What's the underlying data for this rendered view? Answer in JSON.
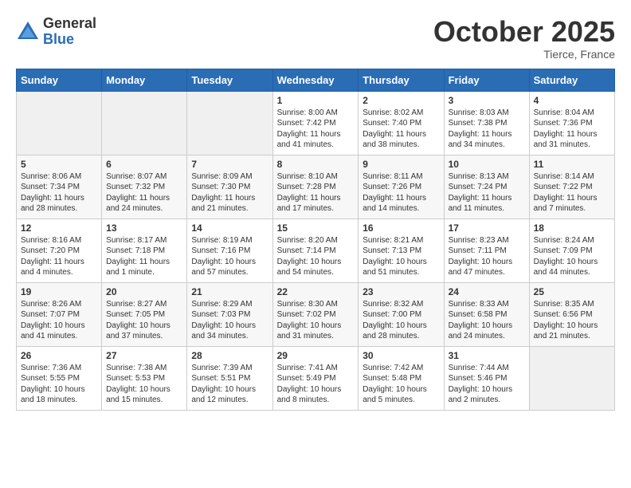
{
  "logo": {
    "general": "General",
    "blue": "Blue"
  },
  "header": {
    "month": "October 2025",
    "location": "Tierce, France"
  },
  "days_of_week": [
    "Sunday",
    "Monday",
    "Tuesday",
    "Wednesday",
    "Thursday",
    "Friday",
    "Saturday"
  ],
  "weeks": [
    [
      {
        "day": "",
        "info": ""
      },
      {
        "day": "",
        "info": ""
      },
      {
        "day": "",
        "info": ""
      },
      {
        "day": "1",
        "info": "Sunrise: 8:00 AM\nSunset: 7:42 PM\nDaylight: 11 hours and 41 minutes."
      },
      {
        "day": "2",
        "info": "Sunrise: 8:02 AM\nSunset: 7:40 PM\nDaylight: 11 hours and 38 minutes."
      },
      {
        "day": "3",
        "info": "Sunrise: 8:03 AM\nSunset: 7:38 PM\nDaylight: 11 hours and 34 minutes."
      },
      {
        "day": "4",
        "info": "Sunrise: 8:04 AM\nSunset: 7:36 PM\nDaylight: 11 hours and 31 minutes."
      }
    ],
    [
      {
        "day": "5",
        "info": "Sunrise: 8:06 AM\nSunset: 7:34 PM\nDaylight: 11 hours and 28 minutes."
      },
      {
        "day": "6",
        "info": "Sunrise: 8:07 AM\nSunset: 7:32 PM\nDaylight: 11 hours and 24 minutes."
      },
      {
        "day": "7",
        "info": "Sunrise: 8:09 AM\nSunset: 7:30 PM\nDaylight: 11 hours and 21 minutes."
      },
      {
        "day": "8",
        "info": "Sunrise: 8:10 AM\nSunset: 7:28 PM\nDaylight: 11 hours and 17 minutes."
      },
      {
        "day": "9",
        "info": "Sunrise: 8:11 AM\nSunset: 7:26 PM\nDaylight: 11 hours and 14 minutes."
      },
      {
        "day": "10",
        "info": "Sunrise: 8:13 AM\nSunset: 7:24 PM\nDaylight: 11 hours and 11 minutes."
      },
      {
        "day": "11",
        "info": "Sunrise: 8:14 AM\nSunset: 7:22 PM\nDaylight: 11 hours and 7 minutes."
      }
    ],
    [
      {
        "day": "12",
        "info": "Sunrise: 8:16 AM\nSunset: 7:20 PM\nDaylight: 11 hours and 4 minutes."
      },
      {
        "day": "13",
        "info": "Sunrise: 8:17 AM\nSunset: 7:18 PM\nDaylight: 11 hours and 1 minute."
      },
      {
        "day": "14",
        "info": "Sunrise: 8:19 AM\nSunset: 7:16 PM\nDaylight: 10 hours and 57 minutes."
      },
      {
        "day": "15",
        "info": "Sunrise: 8:20 AM\nSunset: 7:14 PM\nDaylight: 10 hours and 54 minutes."
      },
      {
        "day": "16",
        "info": "Sunrise: 8:21 AM\nSunset: 7:13 PM\nDaylight: 10 hours and 51 minutes."
      },
      {
        "day": "17",
        "info": "Sunrise: 8:23 AM\nSunset: 7:11 PM\nDaylight: 10 hours and 47 minutes."
      },
      {
        "day": "18",
        "info": "Sunrise: 8:24 AM\nSunset: 7:09 PM\nDaylight: 10 hours and 44 minutes."
      }
    ],
    [
      {
        "day": "19",
        "info": "Sunrise: 8:26 AM\nSunset: 7:07 PM\nDaylight: 10 hours and 41 minutes."
      },
      {
        "day": "20",
        "info": "Sunrise: 8:27 AM\nSunset: 7:05 PM\nDaylight: 10 hours and 37 minutes."
      },
      {
        "day": "21",
        "info": "Sunrise: 8:29 AM\nSunset: 7:03 PM\nDaylight: 10 hours and 34 minutes."
      },
      {
        "day": "22",
        "info": "Sunrise: 8:30 AM\nSunset: 7:02 PM\nDaylight: 10 hours and 31 minutes."
      },
      {
        "day": "23",
        "info": "Sunrise: 8:32 AM\nSunset: 7:00 PM\nDaylight: 10 hours and 28 minutes."
      },
      {
        "day": "24",
        "info": "Sunrise: 8:33 AM\nSunset: 6:58 PM\nDaylight: 10 hours and 24 minutes."
      },
      {
        "day": "25",
        "info": "Sunrise: 8:35 AM\nSunset: 6:56 PM\nDaylight: 10 hours and 21 minutes."
      }
    ],
    [
      {
        "day": "26",
        "info": "Sunrise: 7:36 AM\nSunset: 5:55 PM\nDaylight: 10 hours and 18 minutes."
      },
      {
        "day": "27",
        "info": "Sunrise: 7:38 AM\nSunset: 5:53 PM\nDaylight: 10 hours and 15 minutes."
      },
      {
        "day": "28",
        "info": "Sunrise: 7:39 AM\nSunset: 5:51 PM\nDaylight: 10 hours and 12 minutes."
      },
      {
        "day": "29",
        "info": "Sunrise: 7:41 AM\nSunset: 5:49 PM\nDaylight: 10 hours and 8 minutes."
      },
      {
        "day": "30",
        "info": "Sunrise: 7:42 AM\nSunset: 5:48 PM\nDaylight: 10 hours and 5 minutes."
      },
      {
        "day": "31",
        "info": "Sunrise: 7:44 AM\nSunset: 5:46 PM\nDaylight: 10 hours and 2 minutes."
      },
      {
        "day": "",
        "info": ""
      }
    ]
  ]
}
